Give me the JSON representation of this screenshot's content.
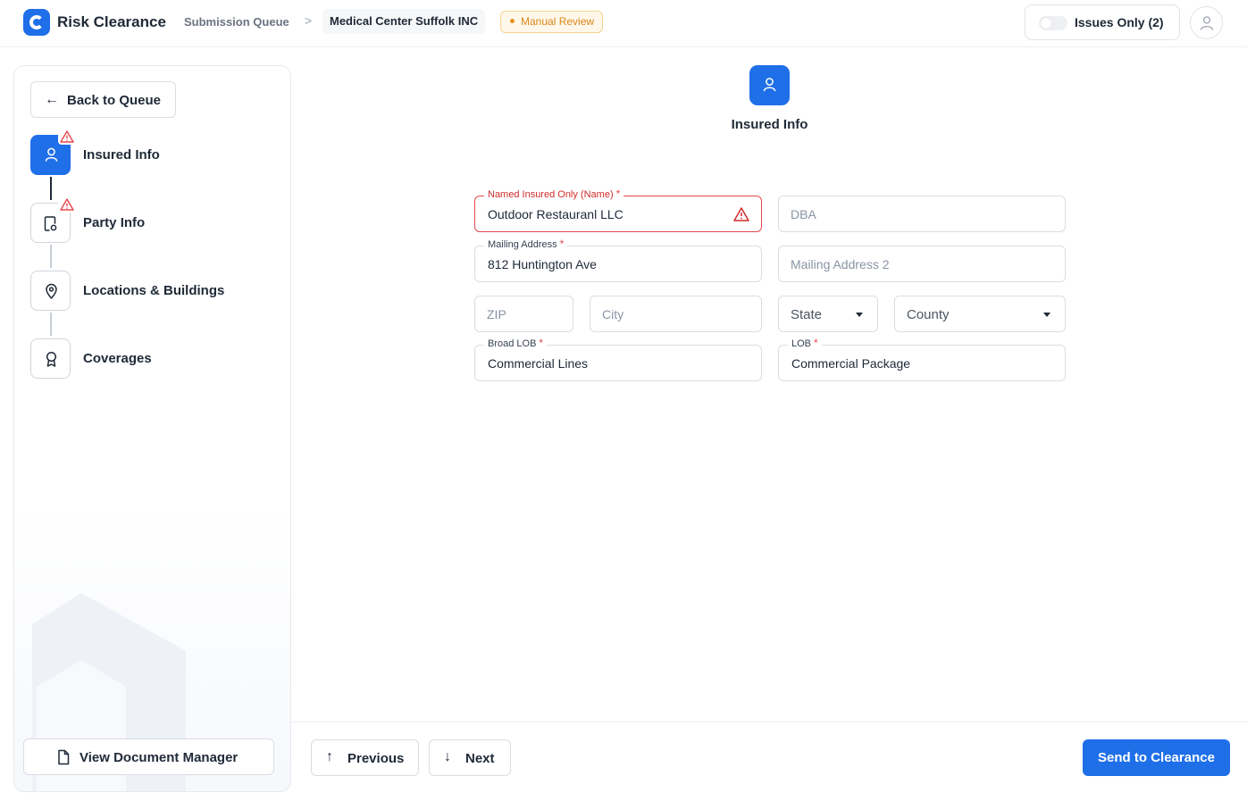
{
  "header": {
    "app_title": "Risk Clearance",
    "breadcrumb": {
      "queue": "Submission Queue",
      "separator": ">",
      "current": "Medical Center Suffolk INC"
    },
    "status_badge": "Manual Review",
    "issues_toggle": {
      "label": "Issues Only (2)",
      "on": false
    }
  },
  "sidebar": {
    "back_label": "Back to Queue",
    "steps": [
      {
        "label": "Insured Info",
        "active": true,
        "warning": true,
        "icon": "user-icon"
      },
      {
        "label": "Party Info",
        "active": false,
        "warning": true,
        "icon": "party-doc-icon"
      },
      {
        "label": "Locations & Buildings",
        "active": false,
        "warning": false,
        "icon": "map-pin-icon"
      },
      {
        "label": "Coverages",
        "active": false,
        "warning": false,
        "icon": "award-icon"
      }
    ],
    "doc_manager_label": "View Document Manager"
  },
  "main": {
    "section_title": "Insured Info",
    "fields": {
      "named_insured": {
        "label": "Named Insured Only (Name)",
        "required": "*",
        "value": "Outdoor Restauranl LLC",
        "error": true
      },
      "dba": {
        "placeholder": "DBA"
      },
      "mailing_address": {
        "label": "Mailing Address",
        "required": "*",
        "value": "812 Huntington Ave"
      },
      "mailing_address_2": {
        "placeholder": "Mailing Address 2"
      },
      "zip": {
        "placeholder": "ZIP"
      },
      "city": {
        "placeholder": "City"
      },
      "state": {
        "placeholder": "State"
      },
      "county": {
        "placeholder": "County"
      },
      "broad_lob": {
        "label": "Broad LOB",
        "required": "*",
        "value": "Commercial Lines"
      },
      "lob": {
        "label": "LOB",
        "required": "*",
        "value": "Commercial Package"
      }
    }
  },
  "footer": {
    "previous_label": "Previous",
    "next_label": "Next",
    "send_label": "Send to Clearance"
  },
  "colors": {
    "accent": "#1f6fe8",
    "error": "#e5484d",
    "warning_badge": "#d9861a"
  }
}
